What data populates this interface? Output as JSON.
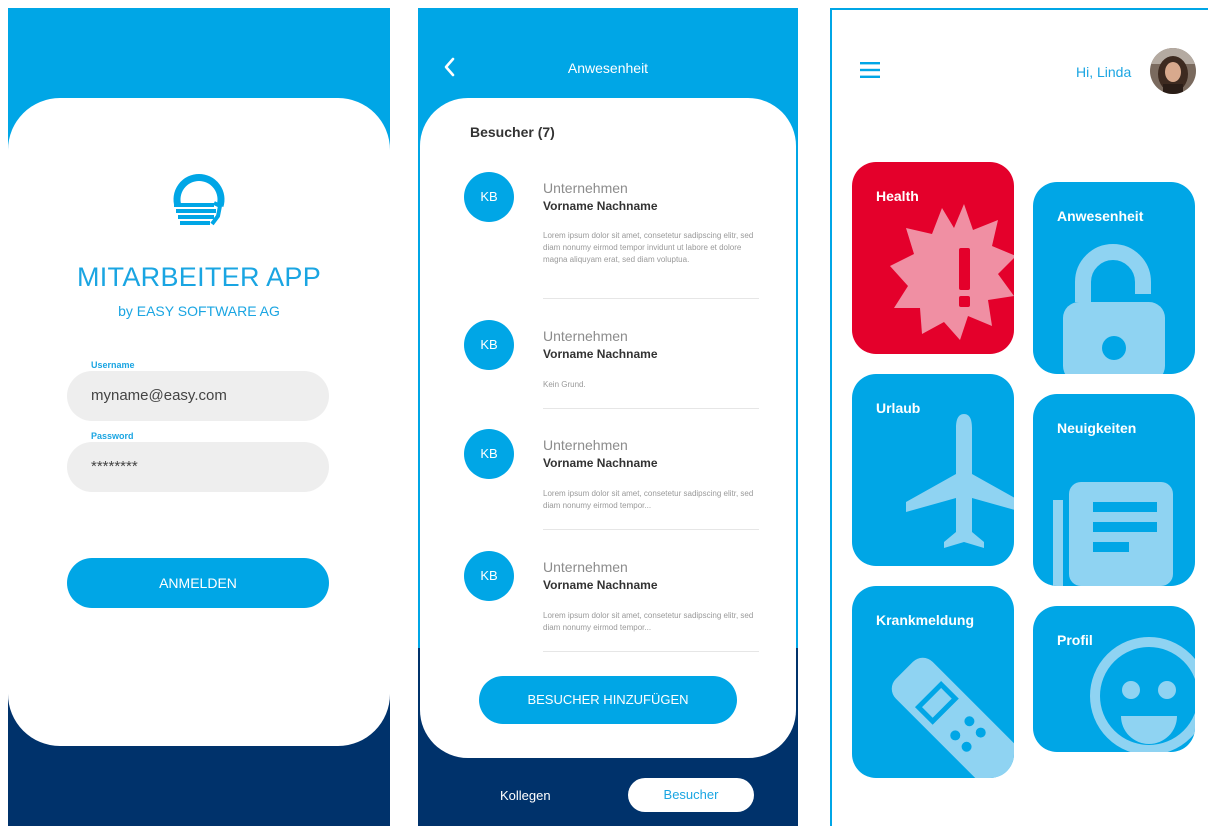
{
  "colors": {
    "primary": "#00a6e6",
    "navy": "#00326b",
    "alert_red": "#e4002b",
    "field_bg": "#eeeeee"
  },
  "login": {
    "title": "MITARBEITER APP",
    "subtitle": "by EASY SOFTWARE AG",
    "username_label": "Username",
    "username_value": "myname@easy.com",
    "password_label": "Password",
    "password_value": "********",
    "submit_label": "ANMELDEN"
  },
  "attendance": {
    "header_title": "Anwesenheit",
    "section_title": "Besucher (7)",
    "visitors": [
      {
        "initials": "KB",
        "company": "Unternehmen",
        "name": "Vorname Nachname",
        "note": "Lorem ipsum dolor sit amet, consetetur sadipscing elitr, sed diam nonumy eirmod tempor invidunt ut labore et dolore magna aliquyam erat, sed diam voluptua."
      },
      {
        "initials": "KB",
        "company": "Unternehmen",
        "name": "Vorname Nachname",
        "note": "Kein Grund."
      },
      {
        "initials": "KB",
        "company": "Unternehmen",
        "name": "Vorname Nachname",
        "note": "Lorem ipsum dolor sit amet, consetetur sadipscing elitr, sed diam nonumy eirmod tempor..."
      },
      {
        "initials": "KB",
        "company": "Unternehmen",
        "name": "Vorname Nachname",
        "note": "Lorem ipsum dolor sit amet, consetetur sadipscing elitr, sed diam nonumy eirmod tempor..."
      }
    ],
    "add_button_label": "BESUCHER HINZUFÜGEN",
    "tabs": {
      "colleagues": "Kollegen",
      "visitors": "Besucher"
    }
  },
  "dashboard": {
    "greeting": "Hi, Linda",
    "tiles": [
      {
        "label": "Health",
        "icon": "alert-badge-icon"
      },
      {
        "label": "Anwesenheit",
        "icon": "unlock-icon"
      },
      {
        "label": "Urlaub",
        "icon": "airplane-icon"
      },
      {
        "label": "Neuigkeiten",
        "icon": "newspaper-icon"
      },
      {
        "label": "Krankmeldung",
        "icon": "bandage-icon"
      },
      {
        "label": "Profil",
        "icon": "smiley-icon"
      }
    ]
  }
}
